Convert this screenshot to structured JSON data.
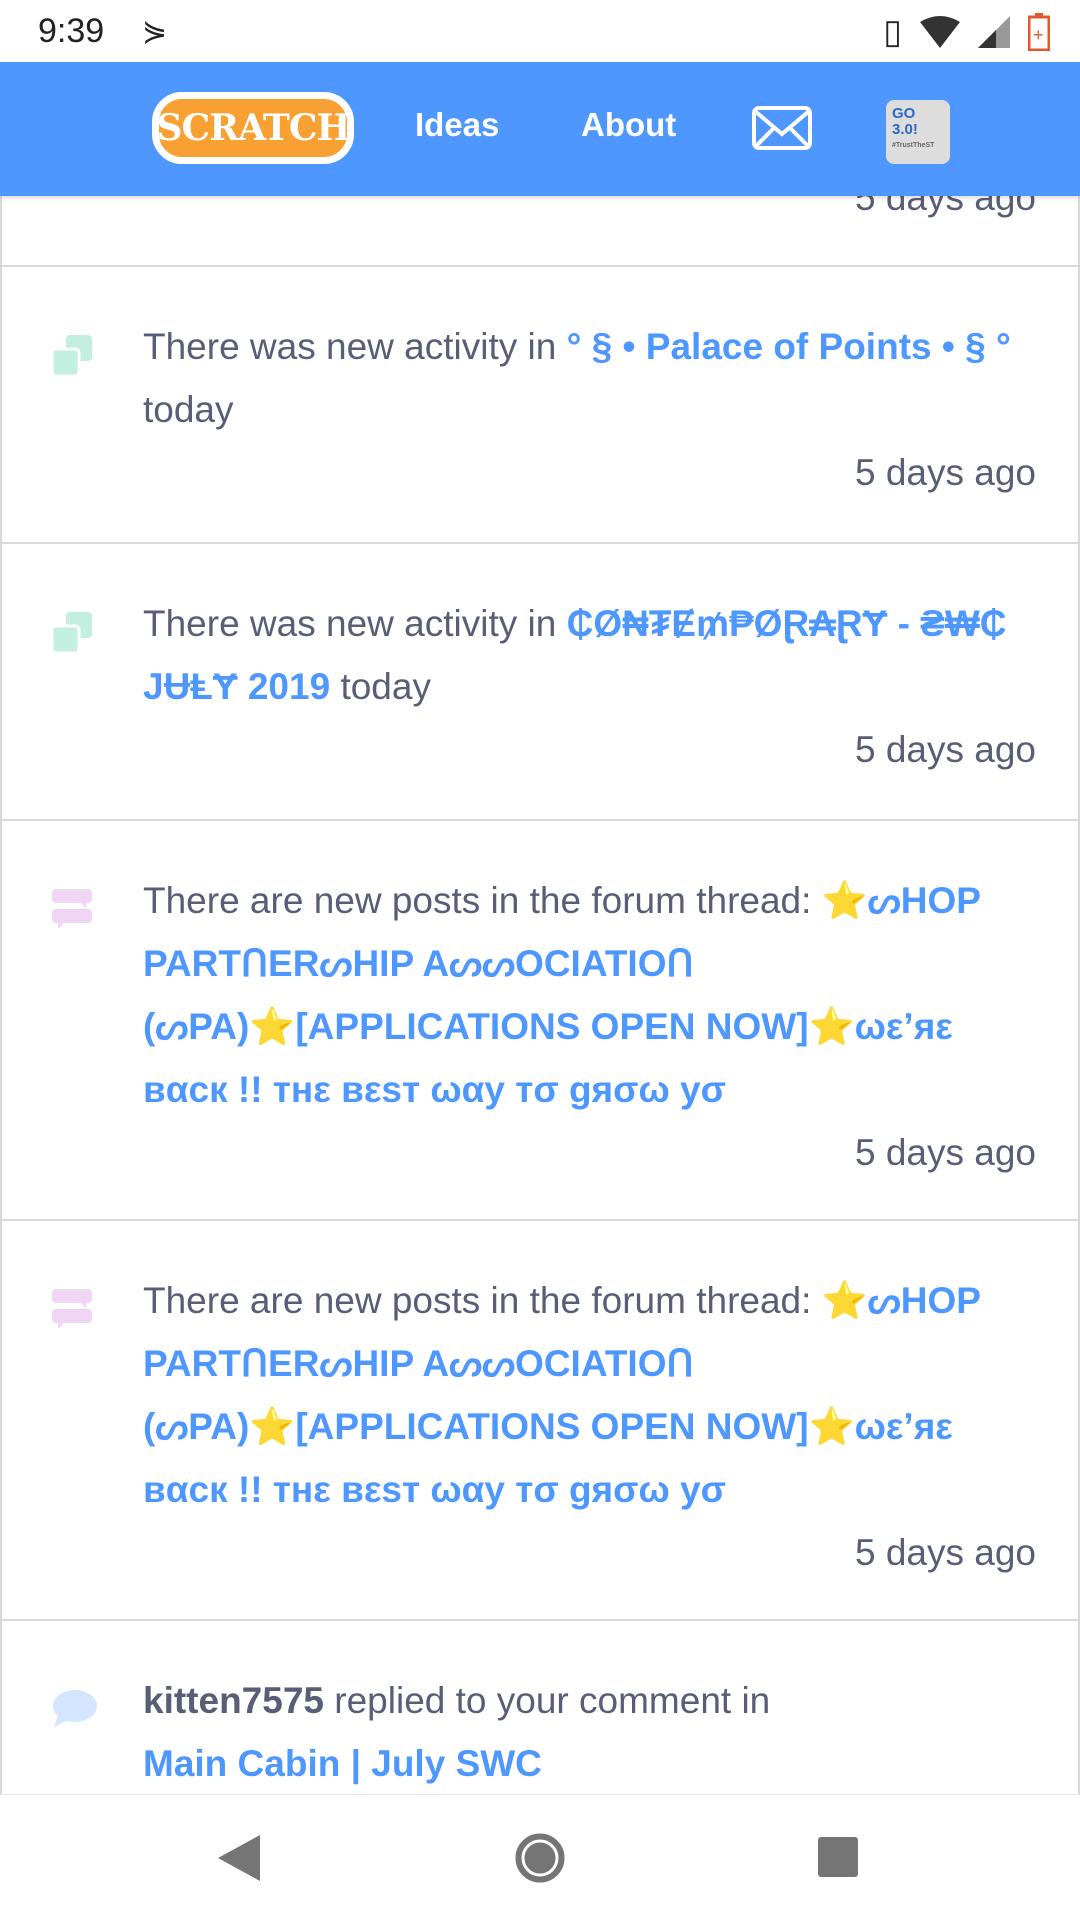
{
  "status_bar": {
    "time": "9:39"
  },
  "header": {
    "logo": "SCRATCH",
    "nav": [
      "Ideas",
      "About"
    ],
    "go_badge": "GO 3.0!",
    "go_tag": "#TrustTheST"
  },
  "notifications": [
    {
      "type": "activity",
      "prefix": "There was new activity in ",
      "link": "° § • Palace of Points • § °",
      "suffix": " today",
      "time": "5 days ago"
    },
    {
      "type": "activity",
      "prefix": "There was new activity in ",
      "link": "₵Ø₦₮Ɇ₥₱ØⱤ₳ⱤɎ - ₴₩₵ JɄⱠɎ 2019",
      "suffix": " today",
      "time": "5 days ago"
    },
    {
      "type": "forum",
      "prefix": "There are new posts in the forum thread: ",
      "link": "⭐ᔕHOP PARTᑎERᔕHIP AᔕᔕOCIATIOᑎ (ᔕPA)⭐[APPLICATIONS OPEN NOW]⭐ωε’яε вαcк !! тнε вεѕт ωαу тσ gяσω уσ",
      "suffix": "",
      "time": "5 days ago"
    },
    {
      "type": "forum",
      "prefix": "There are new posts in the forum thread: ",
      "link": "⭐ᔕHOP PARTᑎERᔕHIP AᔕᔕOCIATIOᑎ (ᔕPA)⭐[APPLICATIONS OPEN NOW]⭐ωε’яε вαcк !! тнε вεѕт ωαу тσ gяσω уσ",
      "suffix": "",
      "time": "5 days ago"
    }
  ],
  "partial_top": {
    "time": "5 days ago"
  },
  "last": {
    "user": "kitten7575",
    "text": " replied to your comment in ",
    "link": "Main Cabin | July SWC"
  },
  "colors": {
    "accent": "#4d97ff",
    "text": "#575e75",
    "activity_icon": "#c3efe0",
    "forum_icon": "#f1d5f4",
    "comment_icon": "#d3e5ff"
  }
}
